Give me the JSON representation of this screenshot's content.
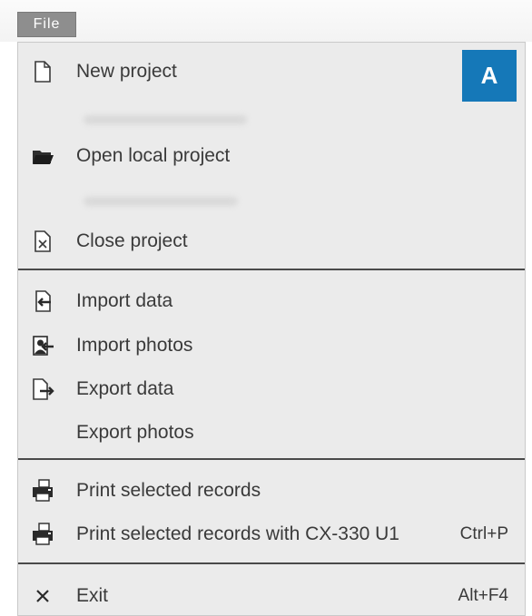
{
  "menu_tab": {
    "label": "File"
  },
  "badge": {
    "label": "A"
  },
  "items": {
    "new_project": {
      "label": "New project",
      "icon": "new-document-icon"
    },
    "open_local_project": {
      "label": "Open local project",
      "icon": "folder-open-icon"
    },
    "close_project": {
      "label": "Close project",
      "icon": "close-document-icon"
    },
    "import_data": {
      "label": "Import data",
      "icon": "import-data-icon"
    },
    "import_photos": {
      "label": "Import photos",
      "icon": "import-photos-icon"
    },
    "export_data": {
      "label": "Export data",
      "icon": "export-data-icon"
    },
    "export_photos": {
      "label": "Export photos"
    },
    "print_selected": {
      "label": "Print selected records",
      "icon": "printer-icon"
    },
    "print_selected_cx": {
      "label": "Print selected records with CX-330 U1",
      "shortcut": "Ctrl+P",
      "icon": "printer-icon"
    },
    "exit": {
      "label": "Exit",
      "shortcut": "Alt+F4",
      "icon": "close-x-icon"
    }
  },
  "colors": {
    "accent": "#1578b8",
    "menu_bg": "#ebebeb",
    "separator": "#4a4a4a"
  }
}
